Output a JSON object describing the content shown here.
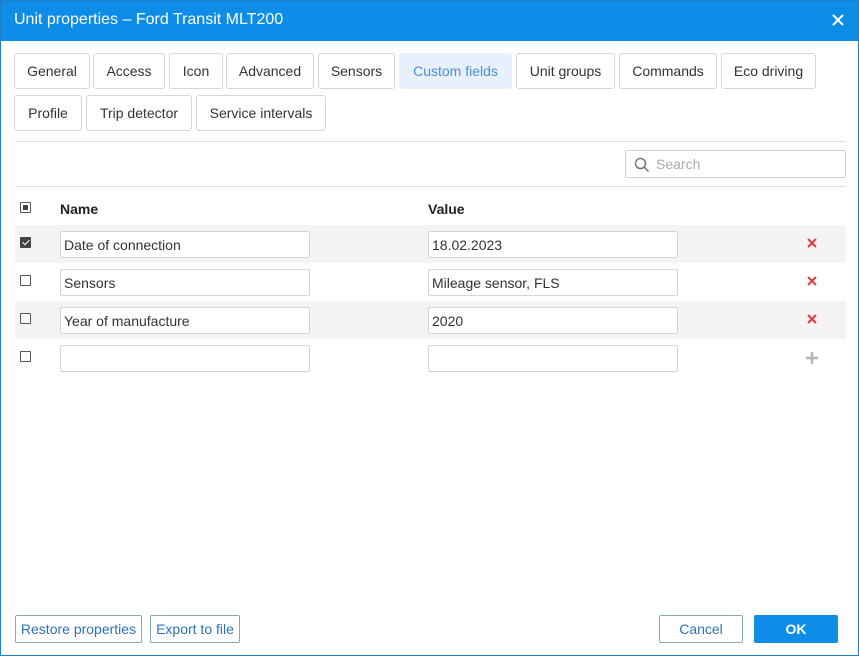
{
  "window": {
    "title": "Unit properties – Ford Transit MLT200"
  },
  "tabs": [
    {
      "label": "General"
    },
    {
      "label": "Access"
    },
    {
      "label": "Icon"
    },
    {
      "label": "Advanced"
    },
    {
      "label": "Sensors"
    },
    {
      "label": "Custom fields",
      "active": true
    },
    {
      "label": "Unit groups"
    },
    {
      "label": "Commands"
    },
    {
      "label": "Eco driving"
    },
    {
      "label": "Profile"
    },
    {
      "label": "Trip detector"
    },
    {
      "label": "Service intervals"
    }
  ],
  "search": {
    "placeholder": "Search",
    "value": ""
  },
  "table": {
    "columns": {
      "name": "Name",
      "value": "Value"
    },
    "rows": [
      {
        "checked": true,
        "name": "Date of connection",
        "value": "18.02.2023"
      },
      {
        "checked": false,
        "name": "Sensors",
        "value": "Mileage sensor, FLS"
      },
      {
        "checked": false,
        "name": "Year of manufacture",
        "value": "2020"
      },
      {
        "checked": false,
        "name": "",
        "value": ""
      }
    ]
  },
  "footer": {
    "restore": "Restore properties",
    "export": "Export to file",
    "cancel": "Cancel",
    "ok": "OK"
  },
  "colors": {
    "accent": "#0d8ce8",
    "delete": "#e03a3a",
    "active_tab_bg": "#e8f0fb",
    "active_tab_text": "#4d90d6"
  },
  "icons": {
    "close": "close-icon",
    "search": "search-icon",
    "delete": "delete-icon",
    "add": "plus-icon"
  }
}
